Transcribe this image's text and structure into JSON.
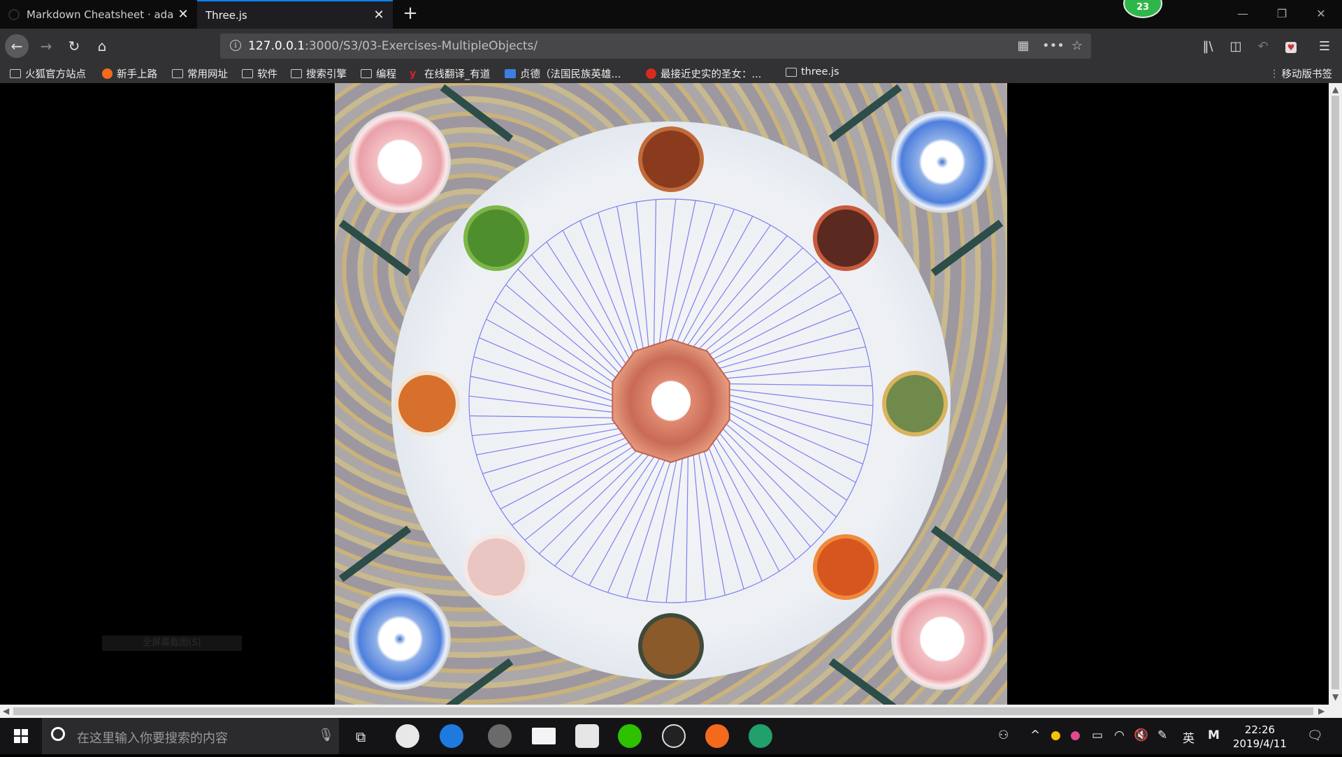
{
  "tabs": [
    {
      "title": "Markdown Cheatsheet · ada",
      "active": false
    },
    {
      "title": "Three.js",
      "active": true
    }
  ],
  "badge_count": "23",
  "window_controls": {
    "minimize": "—",
    "restore": "❐",
    "close": "✕"
  },
  "nav": {
    "back": "←",
    "forward": "→",
    "reload": "↻",
    "home": "⌂"
  },
  "url": {
    "host": "127.0.0.1",
    "path": ":3000/S3/03-Exercises-MultipleObjects/"
  },
  "bookmarks": [
    {
      "label": "火狐官方站点",
      "icon": "folder-icon"
    },
    {
      "label": "新手上路",
      "icon": "firefox-icon"
    },
    {
      "label": "常用网址",
      "icon": "folder-icon"
    },
    {
      "label": "软件",
      "icon": "folder-icon"
    },
    {
      "label": "搜索引擎",
      "icon": "folder-icon"
    },
    {
      "label": "编程",
      "icon": "folder-icon"
    },
    {
      "label": "在线翻译_有道",
      "icon": "youdao-icon"
    },
    {
      "label": "贞德（法国民族英雄...",
      "icon": "baike-icon"
    },
    {
      "label": "最接近史实的圣女：...",
      "icon": "weibo-icon"
    },
    {
      "label": "three.js",
      "icon": "folder-icon"
    }
  ],
  "mobile_bookmarks": "移动版书签",
  "fullscreen_hint": "全屏幕截图(S)",
  "taskbar": {
    "search_placeholder": "在这里输入你要搜索的内容",
    "time": "22:26",
    "date": "2019/4/11",
    "ime": "英",
    "ime_mode": "M"
  },
  "colors": {
    "accent": "#0a84ff",
    "chopstick": "#2c4d48",
    "wire": "#7f7ff0",
    "plate_center": "#d9836b"
  }
}
